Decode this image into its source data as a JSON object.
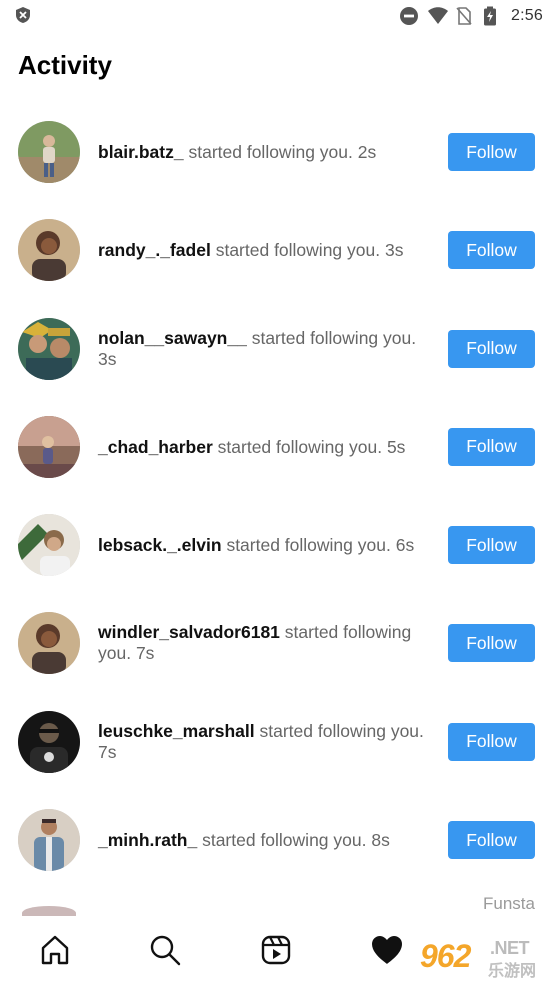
{
  "status_bar": {
    "time": "2:56",
    "icons": [
      "shield-icon",
      "do-not-disturb-icon",
      "wifi-icon",
      "no-sim-icon",
      "battery-charging-icon"
    ]
  },
  "header": {
    "title": "Activity"
  },
  "activity": {
    "action_text": "started following you.",
    "items": [
      {
        "username": "blair.batz_",
        "time": "2s",
        "button": "Follow",
        "avatar_color": "#6d8a5a"
      },
      {
        "username": "randy_._fadel",
        "time": "3s",
        "button": "Follow",
        "avatar_color": "#a8896b"
      },
      {
        "username": "nolan__sawayn__",
        "time": "3s",
        "button": "Follow",
        "avatar_color": "#2d5a63"
      },
      {
        "username": "_chad_harber",
        "time": "5s",
        "button": "Follow",
        "avatar_color": "#8a6a78"
      },
      {
        "username": "lebsack._.elvin",
        "time": "6s",
        "button": "Follow",
        "avatar_color": "#d9d1c6"
      },
      {
        "username": "windler_salvador6181",
        "time": "7s",
        "button": "Follow",
        "avatar_color": "#a8896b"
      },
      {
        "username": "leuschke_marshall",
        "time": "7s",
        "button": "Follow",
        "avatar_color": "#1a1a1a"
      },
      {
        "username": "_minh.rath_",
        "time": "8s",
        "button": "Follow",
        "avatar_color": "#d2c4b5"
      }
    ]
  },
  "overlay": {
    "watermark": "Funsta",
    "badge_number": "962",
    "badge_net": ".NET",
    "badge_cn": "乐游网"
  },
  "bottom_nav": {
    "items": [
      "home-icon",
      "search-icon",
      "reels-icon",
      "activity-heart-icon",
      "profile-icon"
    ]
  },
  "colors": {
    "follow_button": "#3897f0",
    "username": "#111111",
    "secondary_text": "#666666"
  }
}
